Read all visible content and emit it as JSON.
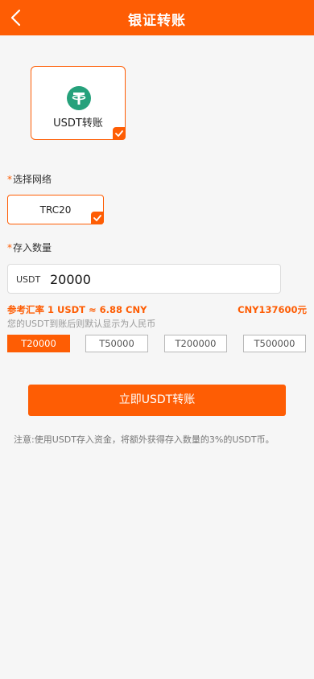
{
  "header": {
    "title": "银证转账",
    "back_icon": "chevron-left-icon"
  },
  "method": {
    "label": "USDT转账",
    "icon": "tether-icon",
    "selected": true
  },
  "network": {
    "label": "选择网络",
    "selected": "TRC20"
  },
  "amount": {
    "label": "存入数量",
    "prefix": "USDT",
    "value": "20000"
  },
  "rate": {
    "text": "参考汇率 1 USDT ≈ 6.88 CNY",
    "cny_total": "CNY137600元"
  },
  "hint": "您的USDT到账后则默认显示为人民币",
  "quick_amounts": [
    "T20000",
    "T50000",
    "T200000",
    "T500000"
  ],
  "quick_active_index": 0,
  "submit_label": "立即USDT转账",
  "notice": "注意:使用USDT存入资金，将额外获得存入数量的3%的USDT币。",
  "colors": {
    "accent": "#fe5d04",
    "tether": "#26a17b",
    "background": "#f6f6f6"
  }
}
